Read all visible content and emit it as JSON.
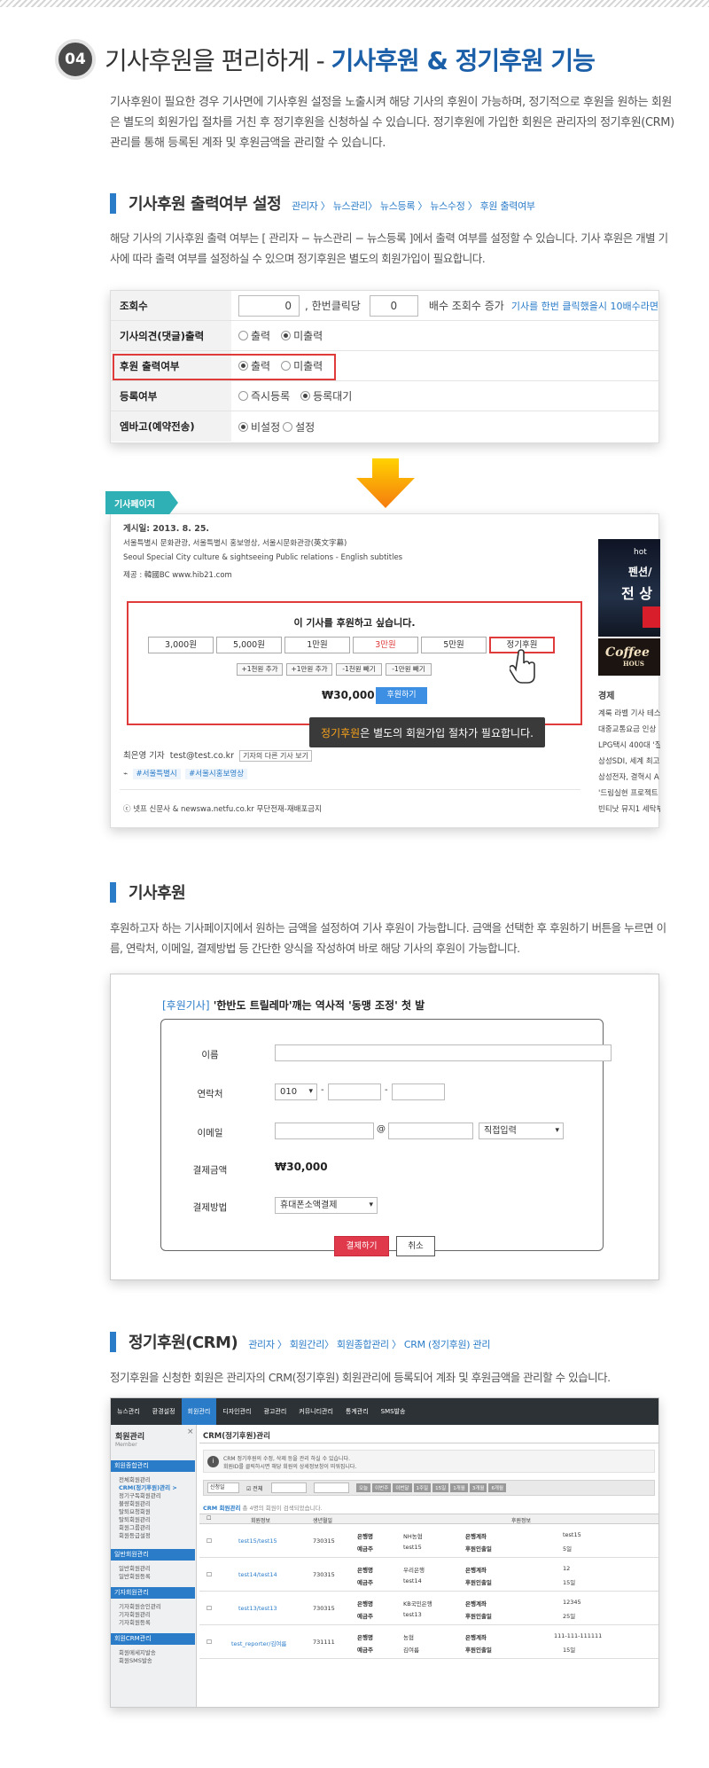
{
  "header": {
    "number": "04",
    "title_main": "기사후원을 편리하게 - ",
    "title_highlight": "기사후원 & 정기후원 기능"
  },
  "intro": "기사후원이 필요한 경우 기사면에 기사후원 설정을 노출시켜 해당 기사의 후원이 가능하며, 정기적으로 후원을 원하는 회원은 별도의 회원가입  절차를 거친 후 정기후원을 신청하실 수 있습니다. 정기후원에 가입한 회원은 관리자의 정기후원(CRM)관리를 통해 등록된 계좌 및 후원금액을 관리할 수 있습니다.",
  "section1": {
    "title": "기사후원 출력여부 설정",
    "path": "관리자 〉 뉴스관리〉 뉴스등록 〉 뉴스수정 〉 후원 출력여부",
    "desc": "해당 기사의 기사후원 출력 여부는 [ 관리자 − 뉴스관리 − 뉴스등록 ]에서 출력 여부를 설정할 수 있습니다. 기사 후원은 개별 기사에 따라 출력 여부를 설정하실 수 있으며 정기후원은 별도의 회원가입이 필요합니다."
  },
  "settings": {
    "views_label": "조회수",
    "views_value": "0",
    "per_click_label": ", 한번클릭당",
    "multiplier_value": "0",
    "multiplier_suffix": "배수 조회수 증가",
    "views_hint": "기사를 한번 클릭했을시 10배수라면",
    "opinion_label": "기사의견(댓글)출력",
    "opinion_opt1": "출력",
    "opinion_opt2": "미출력",
    "donation_label": "후원 출력여부",
    "donation_opt1": "출력",
    "donation_opt2": "미출력",
    "register_label": "등록여부",
    "register_opt1": "즉시등록",
    "register_opt2": "등록대기",
    "embargo_label": "엠바고(예약전송)",
    "embargo_opt1": "비설정",
    "embargo_opt2": "설정"
  },
  "article": {
    "tag": "기사페이지",
    "date": "게시일: 2013. 8. 25.",
    "line1": "서울특별시 문화관광, 서울특별시 홍보영상, 서울시문화관광(英文字幕)",
    "line2": "Seoul Special City culture & sightseeing Public relations - English subtitles",
    "line3": "제공 : 韓國BC www.hib21.com",
    "donate_title": "이 기사를 후원하고 싶습니다.",
    "amounts": [
      "3,000원",
      "5,000원",
      "1만원",
      "3만원",
      "5만원",
      "정기후원"
    ],
    "adjust": [
      "+1천원 추가",
      "+1만원 추가",
      "-1천원 빼기",
      "-1만원 빼기"
    ],
    "total": "₩30,000",
    "donate_btn": "후원하기",
    "tooltip_highlight": "정기후원",
    "tooltip_rest": "은 별도의 회원가입 절차가 필요합니다.",
    "reporter": "최은영 기자",
    "email": "test@test.co.kr",
    "other_articles": "기자의 다른 기사 보기",
    "tags": [
      "#서울특별시",
      "#서울시홍보영상"
    ],
    "copyright": "ⓒ 넷프 신문사 & newswa.netfu.co.kr 무단전재-재배포금지",
    "side_ad_lines": [
      "hot",
      "펜션/",
      "전 상"
    ],
    "coffee_ad": "Coffee",
    "coffee_sub": "HOUS",
    "side_title": "경제",
    "side_news": [
      "계룩 라벨 기사 테스",
      "대중교통요금 인상 ",
      "LPG택시 400대 '질",
      "삼성SDI, 세계 최고",
      "삼성전자, 결혁시 A",
      "'드림실현 프로젝트",
      "빈티낫 뮤지1 세탁부"
    ]
  },
  "section2": {
    "title": "기사후원",
    "desc": "후원하고자 하는 기사페이지에서 원하는 금액을 설정하여 기사 후원이 가능합니다. 금액을 선택한 후 후원하기 버튼을 누르면 이름, 연락처, 이메일, 결제방법 등 간단한 양식을 작성하여 바로 해당 기사의 후원이 가능합니다."
  },
  "form": {
    "article_prefix": "[후원기사]",
    "article_title": "'한반도 트릴레마'깨는 역사적 '동맹 조정' 첫 발",
    "name_label": "이름",
    "phone_label": "연락처",
    "phone_prefix": "010",
    "email_label": "이메일",
    "email_at": "@",
    "email_select": "직접입력",
    "amount_label": "결제금액",
    "amount_value": "₩30,000",
    "method_label": "결제방법",
    "method_value": "휴대폰소액결제",
    "pay_btn": "결제하기",
    "cancel_btn": "취소"
  },
  "section3": {
    "title": "정기후원(CRM)",
    "path": "관리자 〉 회원간리〉 회원종합관리 〉 CRM (정기후원) 관리",
    "desc": "정기후원을 신청한 회원은 관리자의 CRM(정기후원) 회원관리에 등록되어 계좌 및 후원금액을 관리할 수 있습니다."
  },
  "crm": {
    "top_nav": [
      "뉴스관리",
      "환경설정",
      "회원관리",
      "디자인관리",
      "광고관리",
      "커뮤니티관리",
      "통계관리",
      "SMS발송"
    ],
    "top_nav_active": 2,
    "left_title": "회원관리",
    "left_sub": "Member",
    "left_groups": [
      {
        "h": "회원종합관리",
        "items": [
          "전체회원관리",
          "CRM(정기후원)관리 >",
          "정기구독회원관리",
          "불량회원관리",
          "탈퇴요청회원",
          "탈퇴회원관리",
          "회원그룹관리",
          "회원등급설정"
        ]
      },
      {
        "h": "일반회원관리",
        "items": [
          "일반회원관리",
          "일반회원등록"
        ]
      },
      {
        "h": "기자회원관리",
        "items": [
          "기자회원승인관리",
          "기자회원관리",
          "기자회원등록"
        ]
      },
      {
        "h": "회원CRM관리",
        "items": [
          "회원메세지발송",
          "회원SMS발송"
        ]
      }
    ],
    "page_title": "CRM(정기후원)관리",
    "notice1": "CRM 정기후원의 수정, 삭제 등을 관리 하실 수 있습니다.",
    "notice2": "회원ID를 클릭하시면 해당 회원의 상세정보창이 띄워집니다.",
    "filter_label": "신청일",
    "filter_all": "전체",
    "filter_btns": [
      "오늘",
      "이번주",
      "이번달",
      "1주일",
      "15일",
      "1개월",
      "3개월",
      "6개월"
    ],
    "list_title": "CRM 회원관리",
    "list_count": "총 4명의 회원이 검색되었습니다.",
    "col_member": "회원정보",
    "col_birth": "생년월일",
    "col_sponsor": "후원정보",
    "rows": [
      {
        "id": "test15/test15",
        "birth": "730315",
        "bank": "NH농협",
        "holder": "test15",
        "account": "test15",
        "date": "5일"
      },
      {
        "id": "test14/test14",
        "birth": "730315",
        "bank": "우리은행",
        "holder": "test14",
        "account": "12",
        "date": "15일"
      },
      {
        "id": "test13/test13",
        "birth": "730315",
        "bank": "KB국민은행",
        "holder": "test13",
        "account": "12345",
        "date": "25일"
      },
      {
        "id": "test_reporter/김여름",
        "birth": "731111",
        "bank": "농협",
        "holder": "김여름",
        "account": "111-111-111111",
        "date": "15일"
      }
    ],
    "k_bank": "은행명",
    "k_holder": "예금주",
    "k_account": "은행계좌",
    "k_date": "후원인출일"
  }
}
